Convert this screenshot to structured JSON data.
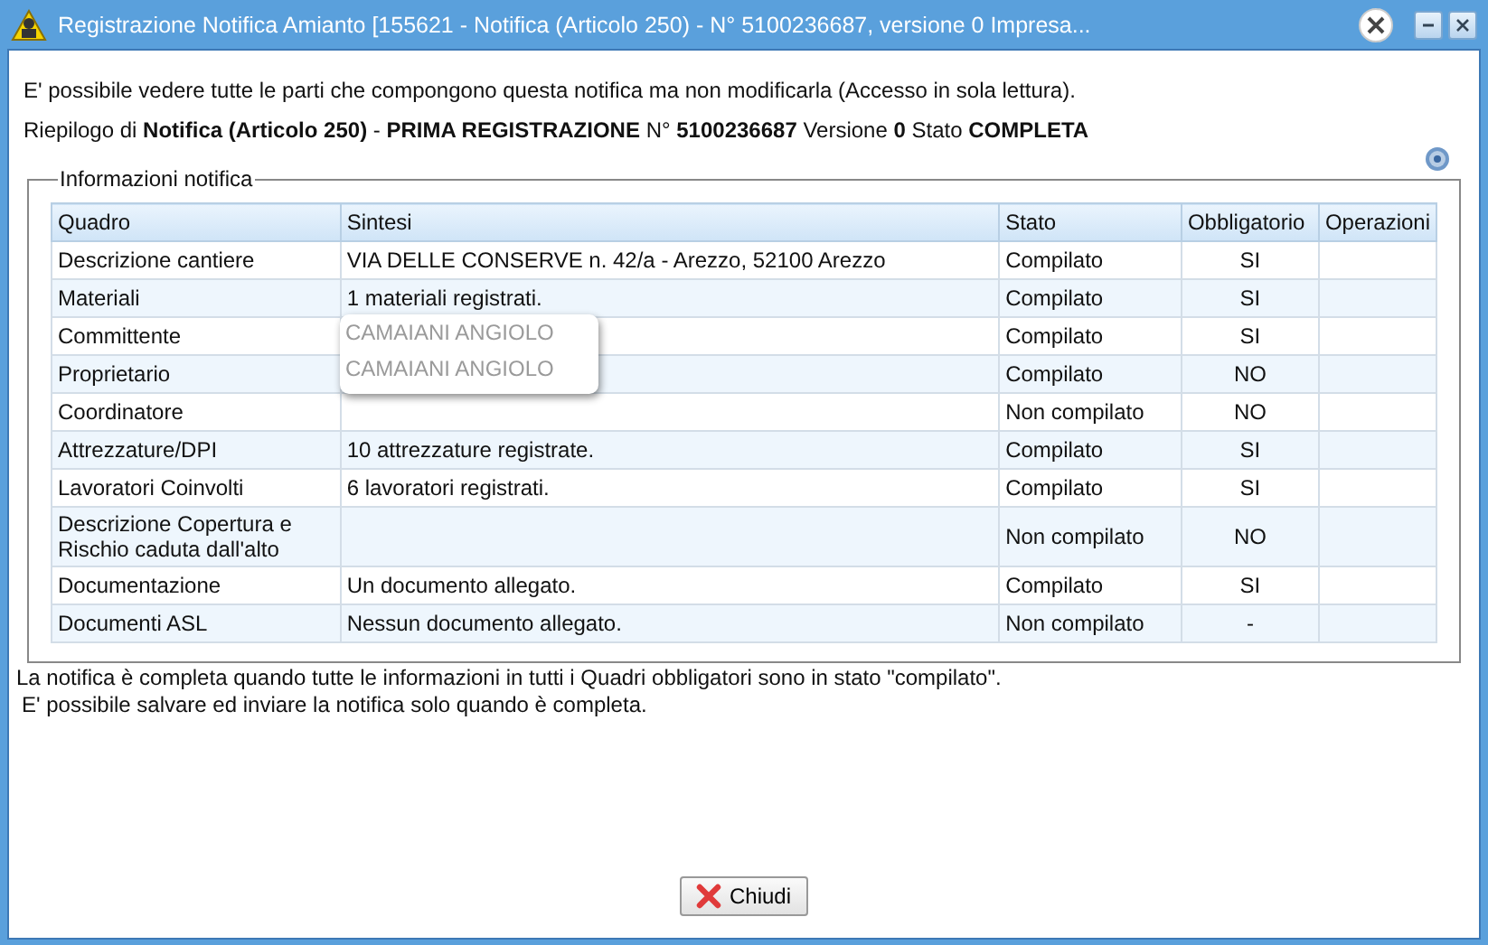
{
  "window": {
    "title": "Registrazione Notifica Amianto [155621 - Notifica (Articolo 250) - N° 5100236687, versione 0 Impresa..."
  },
  "intro": "E' possibile vedere tutte le parti che compongono questa notifica ma non modificarla (Accesso in sola lettura).",
  "summary": "Riepilogo di  **Notifica (Articolo 250)**  - **PRIMA REGISTRAZIONE**  N° **5100236687**  Versione  **0**  Stato  **COMPLETA**",
  "fieldset": {
    "legend": "Informazioni notifica",
    "table": {
      "columns": [
        "Quadro",
        "Sintesi",
        "Stato",
        "Obbligatorio",
        "Operazioni"
      ],
      "rows": [
        {
          "quadro": "Descrizione cantiere",
          "sintesi": "VIA DELLE CONSERVE n. 42/a - Arezzo, 52100 Arezzo",
          "stato": "Compilato",
          "obbligatorio": "SI"
        },
        {
          "quadro": "Materiali",
          "sintesi": "1 materiali registrati.",
          "stato": "Compilato",
          "obbligatorio": "SI"
        },
        {
          "quadro": "Committente",
          "stato": "Compilato",
          "obbligatorio": "SI"
        },
        {
          "quadro": "Proprietario",
          "stato": "Compilato",
          "obbligatorio": "NO"
        },
        {
          "quadro": "Coordinatore",
          "stato": "Non compilato",
          "obbligatorio": "NO"
        },
        {
          "quadro": "Attrezzature/DPI",
          "sintesi": "10 attrezzature registrate.",
          "stato": "Compilato",
          "obbligatorio": "SI"
        },
        {
          "quadro": "Lavoratori Coinvolti",
          "sintesi": "6 lavoratori registrati.",
          "stato": "Compilato",
          "obbligatorio": "SI"
        },
        {
          "quadro": "Descrizione Copertura e Rischio caduta dall'alto",
          "stato": "Non compilato",
          "obbligatorio": "NO"
        },
        {
          "quadro": "Documentazione",
          "sintesi": "Un documento allegato.",
          "stato": "Compilato",
          "obbligatorio": "SI"
        },
        {
          "quadro": "Documenti ASL",
          "sintesi": "Nessun documento allegato.",
          "stato": "Non compilato",
          "obbligatorio": "-"
        }
      ]
    },
    "popup": {
      "lines": [
        "CAMAIANI ANGIOLO",
        "CAMAIANI ANGIOLO"
      ]
    }
  },
  "notes": [
    "La notifica è completa quando tutte le informazioni in tutti i Quadri obbligatori sono in stato \"compilato\".",
    "E' possibile salvare ed inviare la notifica solo quando è completa."
  ],
  "buttons": [
    {
      "label": "Chiudi",
      "kind": "close"
    }
  ]
}
